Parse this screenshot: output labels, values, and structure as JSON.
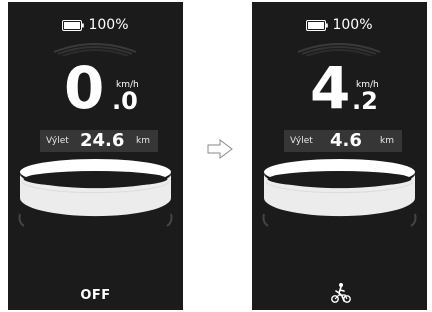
{
  "left": {
    "battery": "100%",
    "speed_int": "0",
    "speed_dec": ".0",
    "speed_unit": "km/h",
    "trip_label": "Výlet",
    "trip_value": "24.6",
    "trip_unit": "km",
    "assist_mode": "OFF",
    "battery_level": 1.0
  },
  "right": {
    "battery": "100%",
    "speed_int": "4",
    "speed_dec": ".2",
    "speed_unit": "km/h",
    "trip_label": "Výlet",
    "trip_value": "4.6",
    "trip_unit": "km",
    "assist_mode_icon": "walk-assist-icon",
    "battery_level": 1.0
  },
  "colors": {
    "screen_bg": "#1b1b1b",
    "trip_bar_bg": "#363636",
    "text": "#ffffff"
  }
}
